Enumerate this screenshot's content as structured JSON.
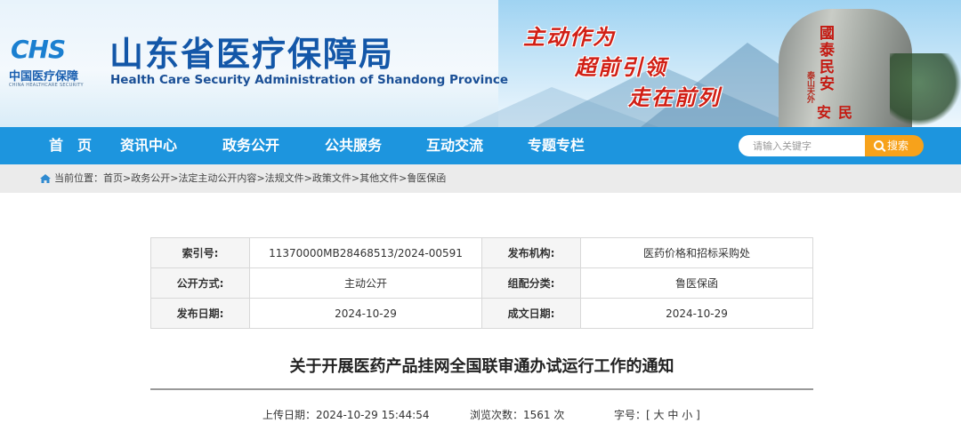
{
  "header": {
    "logo_mark": "CHS",
    "logo_cn": "中国医疗保障",
    "logo_en": "CHINA HEALTHCARE SECURITY",
    "title": "山东省医疗保障局",
    "subtitle": "Health Care Security Administration of Shandong Province",
    "slogan": [
      "主动作为",
      "超前引领",
      "走在前列"
    ],
    "rock_inscription": [
      "國泰民安",
      "泰山天外",
      "民安"
    ]
  },
  "nav": {
    "items": [
      "首　页",
      "资讯中心",
      "政务公开",
      "公共服务",
      "互动交流",
      "专题专栏"
    ],
    "search_placeholder": "请输入关键字",
    "search_button": "搜索"
  },
  "breadcrumb": {
    "prefix": "当前位置：",
    "items": [
      "首页",
      "政务公开",
      "法定主动公开内容",
      "法规文件",
      "政策文件",
      "其他文件",
      "鲁医保函"
    ],
    "separator": ">"
  },
  "info": {
    "rows": [
      {
        "label1": "索引号:",
        "value1": "11370000MB28468513/2024-00591",
        "label2": "发布机构:",
        "value2": "医药价格和招标采购处"
      },
      {
        "label1": "公开方式:",
        "value1": "主动公开",
        "label2": "组配分类:",
        "value2": "鲁医保函"
      },
      {
        "label1": "发布日期:",
        "value1": "2024-10-29",
        "label2": "成文日期:",
        "value2": "2024-10-29"
      }
    ]
  },
  "article": {
    "title": "关于开展医药产品挂网全国联审通办试运行工作的通知",
    "upload_label": "上传日期：",
    "upload_value": "2024-10-29 15:44:54",
    "views_label": "浏览次数：",
    "views_value": "1561",
    "views_unit": "次",
    "font_label": "字号：",
    "font_open": "[",
    "font_options": [
      "大",
      "中",
      "小"
    ],
    "font_close": "]"
  },
  "colors": {
    "nav_bg": "#1d95de",
    "search_button": "#f7a21b",
    "title_blue": "#1357a8",
    "slogan_red": "#d11f15"
  }
}
